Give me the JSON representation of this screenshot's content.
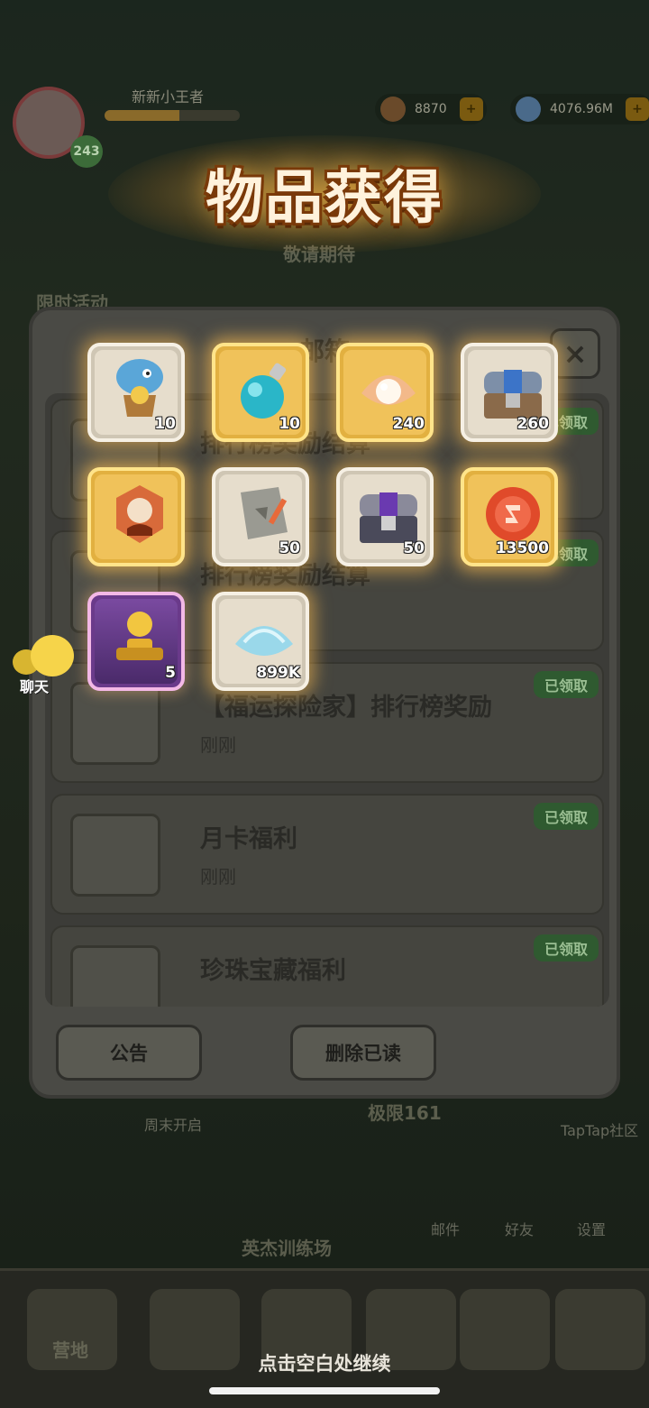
{
  "title": "物品获得",
  "player": {
    "name": "新新小王者",
    "level": "243"
  },
  "resources": [
    {
      "icon": "gem-pouch-icon",
      "value": "8870"
    },
    {
      "icon": "crystal-icon",
      "value": "4076.96M"
    }
  ],
  "background_labels": {
    "event": "限时活动",
    "banner": "敬请期待",
    "limit": "极限161",
    "tap": "TapTap社区",
    "training": "英杰训练场",
    "mail": "邮件",
    "friends": "好友",
    "settings": "设置",
    "camp": "营地",
    "weekend": "周末开启"
  },
  "mail_panel": {
    "title": "邮箱",
    "close_label": "×",
    "items": [
      {
        "title": "排行榜奖励结算",
        "time": "",
        "status": "已领取"
      },
      {
        "title": "排行榜奖励结算",
        "time": "",
        "status": "已领取"
      },
      {
        "title": "【福运探险家】排行榜奖励",
        "time": "刚刚",
        "status": "已领取"
      },
      {
        "title": "月卡福利",
        "time": "刚刚",
        "status": "已领取"
      },
      {
        "title": "珍珠宝藏福利",
        "time": "",
        "status": "已领取"
      }
    ],
    "announcement_label": "公告",
    "delete_read_label": "删除已读"
  },
  "rewards": [
    {
      "icon": "dino-balloon-basket-icon",
      "quantity": "10",
      "rarity": "common"
    },
    {
      "icon": "blue-potion-bottle-icon",
      "quantity": "10",
      "rarity": "gold"
    },
    {
      "icon": "pearl-shell-icon",
      "quantity": "240",
      "rarity": "gold"
    },
    {
      "icon": "blue-treasure-chest-icon",
      "quantity": "260",
      "rarity": "common"
    },
    {
      "icon": "hero-portrait-medal-icon",
      "quantity": "",
      "rarity": "gold"
    },
    {
      "icon": "stone-tablet-pen-icon",
      "quantity": "50",
      "rarity": "common"
    },
    {
      "icon": "purple-treasure-chest-icon",
      "quantity": "50",
      "rarity": "common"
    },
    {
      "icon": "red-coin-medal-icon",
      "quantity": "13500",
      "rarity": "gold"
    },
    {
      "icon": "golden-trophy-icon",
      "quantity": "5",
      "rarity": "epic"
    },
    {
      "icon": "blue-crystal-shell-icon",
      "quantity": "899K",
      "rarity": "common"
    }
  ],
  "chat_label": "聊天",
  "continue_hint": "点击空白处继续"
}
